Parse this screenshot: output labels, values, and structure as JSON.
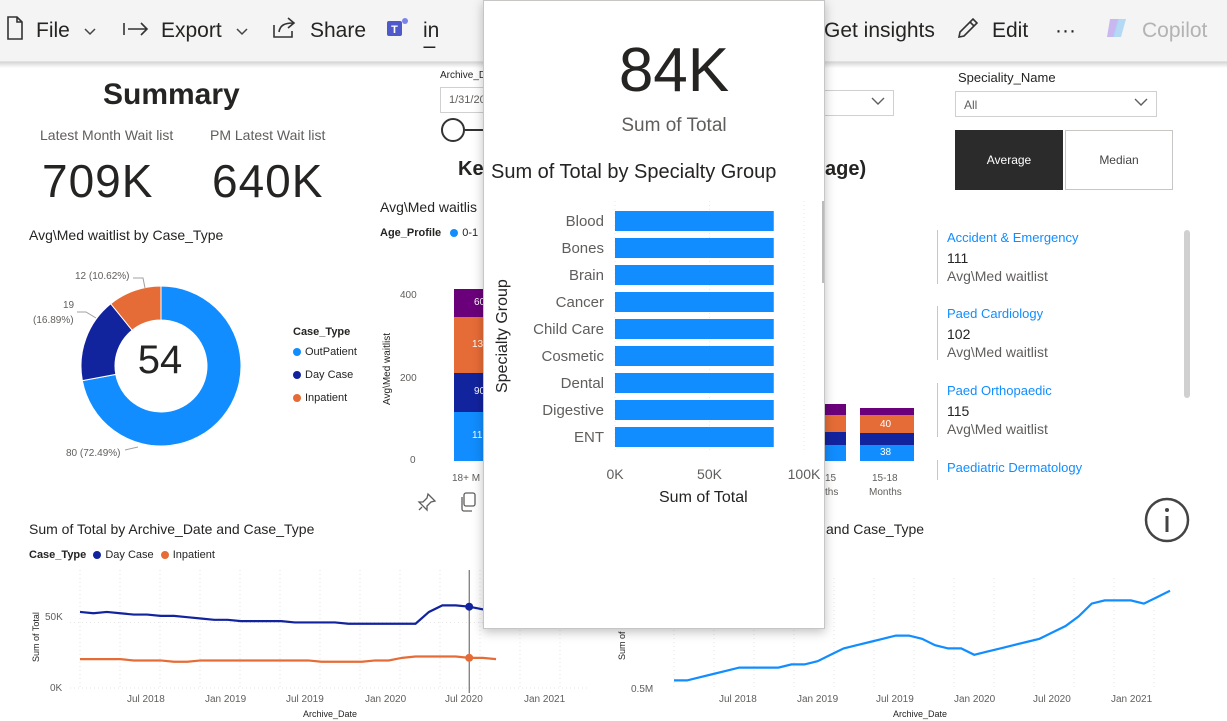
{
  "toolbar": {
    "file": "File",
    "export": "Export",
    "share": "Share",
    "chat": "Chat in Teams",
    "insights": "Get insights",
    "edit": "Edit",
    "more": "···",
    "copilot": "Copilot"
  },
  "summary": {
    "title": "Summary",
    "latest_label": "Latest Month Wait list",
    "latest_value": "709K",
    "pm_label": "PM Latest Wait list",
    "pm_value": "640K"
  },
  "slicers": {
    "archive_label": "Archive_D",
    "archive_value": "1/31/20",
    "speciality_label": "Speciality_Name",
    "speciality_value": "All",
    "average": "Average",
    "median": "Median"
  },
  "donut": {
    "title": "Avg\\Med waitlist by Case_Type",
    "center": "54",
    "legend_title": "Case_Type",
    "colors": [
      "#118dff",
      "#12239e",
      "#e66c37"
    ],
    "chart_data": {
      "type": "pie",
      "slices": [
        {
          "name": "OutPatient",
          "value": 80,
          "label": "80 (72.49%)"
        },
        {
          "name": "Day Case",
          "value": 19,
          "label": "19 (16.89%)"
        },
        {
          "name": "Inpatient",
          "value": 12,
          "label": "12 (10.62%)"
        }
      ]
    },
    "label_lines": {
      "inpatient": "12 (10.62%)",
      "daycase_1": "19",
      "daycase_2": "(16.89%)",
      "outpatient": "80 (72.49%)"
    }
  },
  "age_chart": {
    "title": "Avg\\Med waitlis",
    "legend_title": "Age_Profile",
    "legend_first": "0-1",
    "ylabel": "Avg\\Med waitlist",
    "yticks": [
      "400",
      "200",
      "0"
    ],
    "key_title_left": "Ke",
    "key_title_right": "age)",
    "left_bar": {
      "label": "18+ M",
      "segments": [
        "60",
        "13",
        "90",
        "11"
      ]
    },
    "right_bar_1": {
      "label_1": "15",
      "label_2": "ths"
    },
    "right_bar_2": {
      "label_1": "15-18",
      "label_2": "Months",
      "segments": [
        "40",
        "38"
      ]
    },
    "colors": {
      "purple": "#6b007b",
      "orange": "#e66c37",
      "navy": "#12239e",
      "blue": "#118dff"
    }
  },
  "specialties": [
    {
      "name": "Accident & Emergency",
      "value": "111",
      "sub": "Avg\\Med waitlist"
    },
    {
      "name": "Paed Cardiology",
      "value": "102",
      "sub": "Avg\\Med waitlist"
    },
    {
      "name": "Paed Orthopaedic",
      "value": "115",
      "sub": "Avg\\Med waitlist"
    },
    {
      "name": "Paediatric Dermatology",
      "value": "",
      "sub": ""
    }
  ],
  "line_left": {
    "title": "Sum of Total by Archive_Date and Case_Type",
    "legend_title": "Case_Type",
    "legend": [
      "Day Case",
      "Inpatient"
    ],
    "ylabel": "Sum of Total",
    "xlabel": "Archive_Date",
    "yticks": [
      "50K",
      "0K"
    ],
    "xticks": [
      "Jul 2018",
      "Jan 2019",
      "Jul 2019",
      "Jan 2020",
      "Jul 2020",
      "Jan 2021"
    ],
    "chart_data": {
      "type": "line",
      "x": [
        "2018-02",
        "2018-03",
        "2018-04",
        "2018-05",
        "2018-06",
        "2018-07",
        "2018-08",
        "2018-09",
        "2018-10",
        "2018-11",
        "2018-12",
        "2019-01",
        "2019-02",
        "2019-03",
        "2019-04",
        "2019-05",
        "2019-06",
        "2019-07",
        "2019-08",
        "2019-09",
        "2019-10",
        "2019-11",
        "2019-12",
        "2020-01",
        "2020-02",
        "2020-03",
        "2020-04",
        "2020-05",
        "2020-06",
        "2020-07",
        "2020-08",
        "2020-09"
      ],
      "series": [
        {
          "name": "Day Case",
          "color": "#12239e",
          "values": [
            58,
            57,
            58,
            57,
            56,
            56,
            55,
            55,
            54,
            53,
            52,
            52,
            51,
            51,
            51,
            51,
            50,
            50,
            50,
            50,
            49,
            49,
            49,
            49,
            49,
            49,
            58,
            63,
            63,
            62,
            60,
            58
          ]
        },
        {
          "name": "Inpatient",
          "color": "#e66c37",
          "values": [
            22,
            22,
            22,
            22,
            21,
            21,
            21,
            20,
            20,
            21,
            21,
            21,
            21,
            21,
            21,
            21,
            21,
            21,
            20,
            20,
            20,
            20,
            21,
            21,
            23,
            24,
            24,
            24,
            24,
            23,
            23,
            22
          ]
        }
      ],
      "ylim": [
        0,
        90
      ]
    },
    "highlight": "2020-07"
  },
  "line_right": {
    "title_fragment": "and Case_Type",
    "ylabel": "Sum of",
    "xlabel": "Archive_Date",
    "yticks": [
      "0.5M"
    ],
    "xticks": [
      "Jul 2018",
      "Jan 2019",
      "Jul 2019",
      "Jan 2020",
      "Jul 2020",
      "Jan 2021"
    ],
    "chart_data": {
      "type": "line",
      "x": [
        "2018-02",
        "2018-03",
        "2018-04",
        "2018-05",
        "2018-06",
        "2018-07",
        "2018-08",
        "2018-09",
        "2018-10",
        "2018-11",
        "2018-12",
        "2019-01",
        "2019-02",
        "2019-03",
        "2019-04",
        "2019-05",
        "2019-06",
        "2019-07",
        "2019-08",
        "2019-09",
        "2019-10",
        "2019-11",
        "2019-12",
        "2020-01",
        "2020-02",
        "2020-03",
        "2020-04",
        "2020-05",
        "2020-06",
        "2020-07",
        "2020-08",
        "2020-09",
        "2020-10",
        "2020-11",
        "2020-12",
        "2021-01",
        "2021-02",
        "2021-03",
        "2021-04"
      ],
      "series": [
        {
          "name": "OutPatient",
          "color": "#118dff",
          "values": [
            0.5,
            0.5,
            0.51,
            0.52,
            0.53,
            0.54,
            0.54,
            0.54,
            0.54,
            0.55,
            0.55,
            0.56,
            0.58,
            0.6,
            0.61,
            0.62,
            0.63,
            0.64,
            0.64,
            0.63,
            0.61,
            0.6,
            0.6,
            0.58,
            0.59,
            0.6,
            0.61,
            0.62,
            0.63,
            0.65,
            0.67,
            0.7,
            0.74,
            0.75,
            0.75,
            0.75,
            0.74,
            0.76,
            0.78
          ]
        }
      ],
      "ylim": [
        0.47,
        0.82
      ]
    }
  },
  "popup": {
    "value": "84K",
    "sub": "Sum of Total",
    "title": "Sum of Total by Specialty Group",
    "ylabel": "Specialty Group",
    "xlabel": "Sum of Total",
    "xticks": [
      "0K",
      "50K",
      "100K"
    ],
    "bar_color": "#118dff",
    "chart_data": {
      "type": "bar",
      "orientation": "horizontal",
      "categories": [
        "Blood",
        "Bones",
        "Brain",
        "Cancer",
        "Child Care",
        "Cosmetic",
        "Dental",
        "Digestive",
        "ENT"
      ],
      "values": [
        84,
        84,
        84,
        84,
        84,
        84,
        84,
        84,
        84
      ],
      "xlim": [
        0,
        100
      ],
      "unit": "K"
    }
  }
}
